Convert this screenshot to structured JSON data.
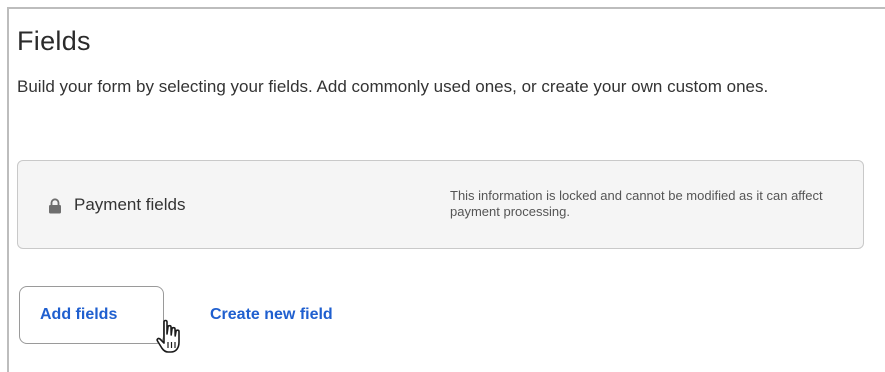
{
  "section": {
    "title": "Fields",
    "description": "Build your form by selecting your fields. Add commonly used ones, or create your own custom ones."
  },
  "locked_card": {
    "icon": "lock-icon",
    "label": "Payment fields",
    "note": "This information is locked and cannot be modified as it can affect payment processing."
  },
  "actions": {
    "add_fields_label": "Add fields",
    "create_field_label": "Create new field"
  },
  "colors": {
    "link_blue": "#1f5fcf",
    "card_bg": "#f5f5f5"
  }
}
